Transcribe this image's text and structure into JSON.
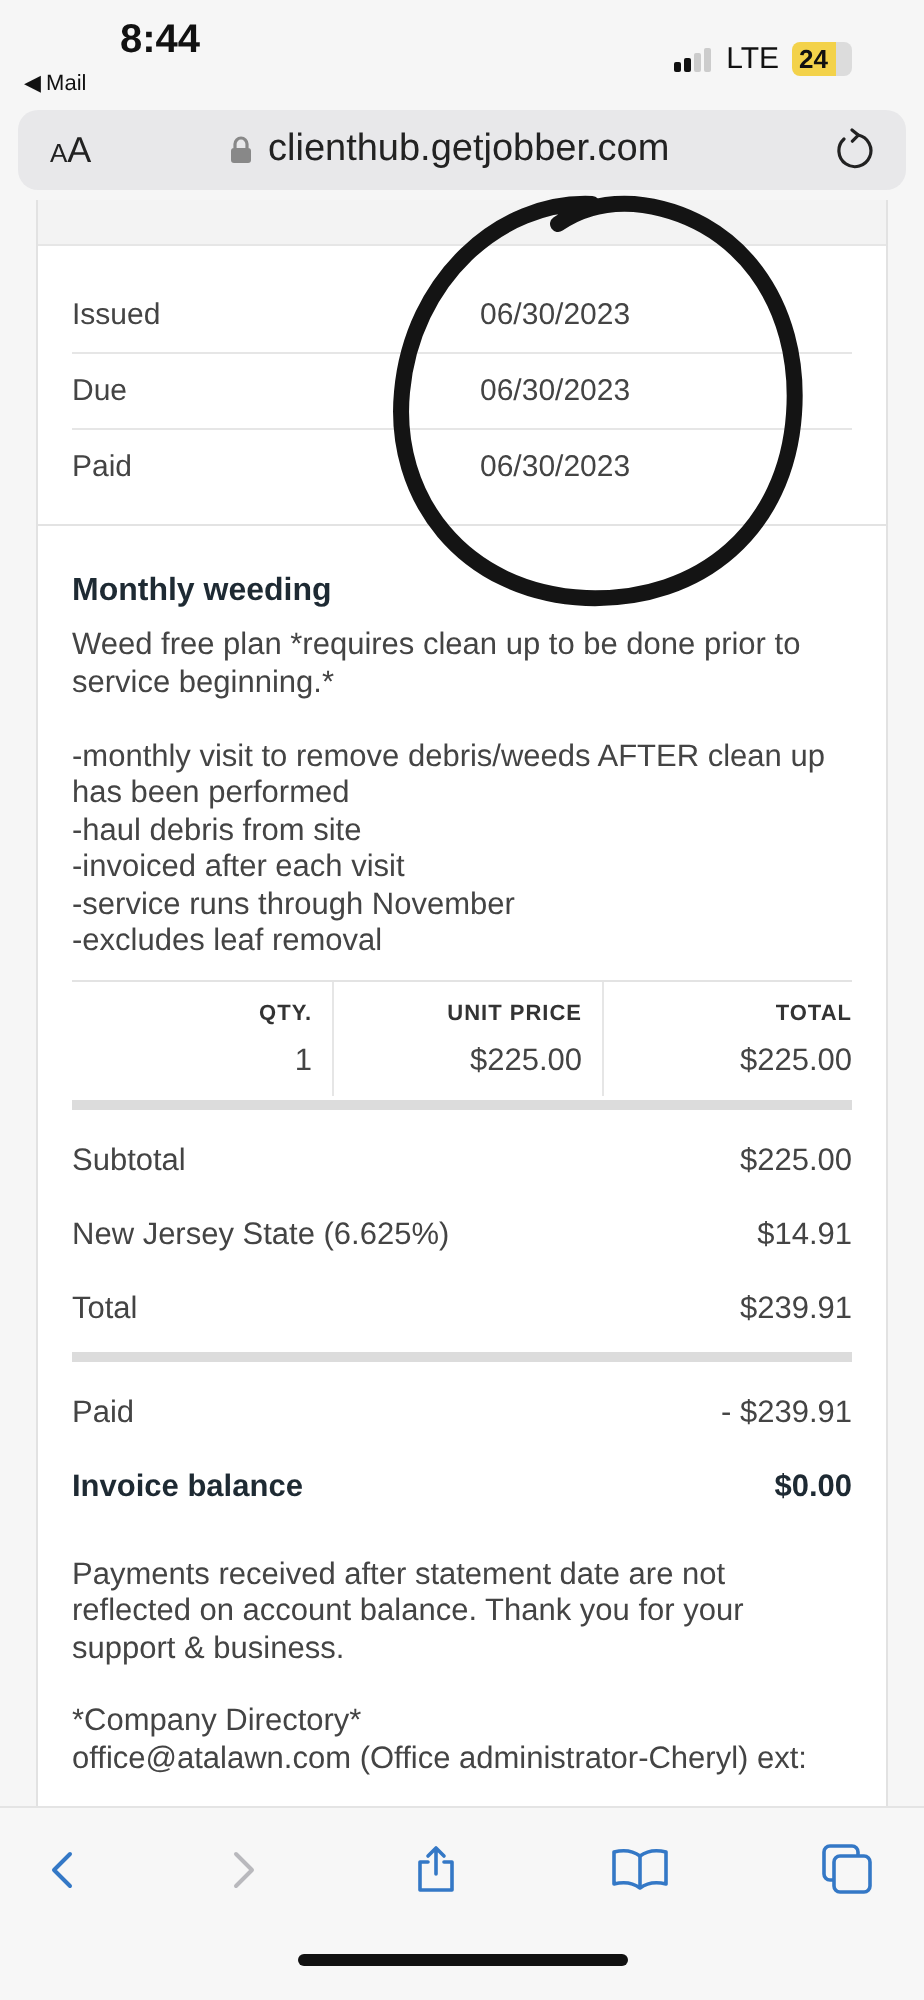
{
  "status_bar": {
    "time": "8:44",
    "back_app": "◀ Mail",
    "network": "LTE",
    "battery": "24"
  },
  "address_bar": {
    "text_size": "AA",
    "url": "clienthub.getjobber.com"
  },
  "invoice": {
    "dates": [
      {
        "label": "Issued",
        "value": "06/30/2023"
      },
      {
        "label": "Due",
        "value": "06/30/2023"
      },
      {
        "label": "Paid",
        "value": "06/30/2023"
      }
    ],
    "line_item": {
      "name": "Monthly weeding",
      "description": "Weed free plan *requires clean up to be done prior to service beginning.*\n\n-monthly visit to remove debris/weeds AFTER clean up has been performed\n-haul debris from site\n-invoiced after each visit\n-service runs through November\n-excludes leaf removal"
    },
    "table": {
      "columns": [
        "QTY.",
        "UNIT PRICE",
        "TOTAL"
      ],
      "rows": [
        [
          "1",
          "$225.00",
          "$225.00"
        ]
      ]
    },
    "totals": [
      {
        "label": "Subtotal",
        "value": "$225.00",
        "kind": "amount",
        "divider_before": true
      },
      {
        "label": "New Jersey State (6.625%)",
        "value": "$14.91",
        "kind": "amount",
        "divider_before": false
      },
      {
        "label": "Total",
        "value": "$239.91",
        "kind": "amount",
        "divider_before": false
      },
      {
        "label": "Paid",
        "value": "- $239.91",
        "kind": "amount",
        "divider_before": true
      },
      {
        "label": "Invoice balance",
        "value": "$0.00",
        "kind": "balance",
        "divider_before": false
      }
    ],
    "note": "Payments received after statement date are not reflected on account balance. Thank you for your support & business.",
    "directory": "*Company Directory*\noffice@atalawn.com (Office administrator-Cheryl) ext:"
  },
  "toolbar": [
    {
      "kind": "back",
      "disabled": false
    },
    {
      "kind": "forward",
      "disabled": true
    },
    {
      "kind": "share",
      "disabled": false
    },
    {
      "kind": "bookmarks",
      "disabled": false
    },
    {
      "kind": "tabs",
      "disabled": false
    }
  ]
}
